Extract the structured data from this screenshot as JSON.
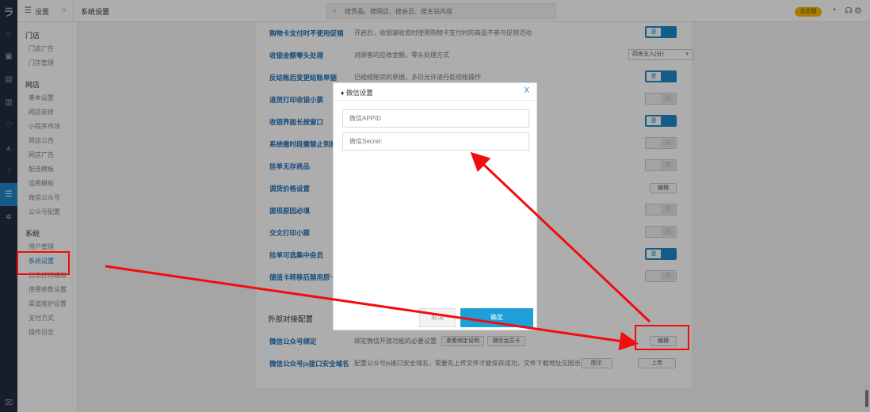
{
  "rail": {
    "logo": "ラ",
    "icons": [
      "home-icon",
      "store-icon",
      "calendar-icon",
      "report-icon",
      "heart-icon",
      "chart-icon",
      "stats-icon",
      "settings-list-icon",
      "puzzle-icon"
    ],
    "bottom": "⌧"
  },
  "topbar": {
    "menu_label": "设置",
    "page_title": "系统设置",
    "search_placeholder": "搜货品、搜网店、搜会员、搜主站内容",
    "badge": "企业版"
  },
  "sidebar": {
    "groups": [
      {
        "title": "门店",
        "items": [
          "门店广告",
          "门店管理"
        ]
      },
      {
        "title": "网店",
        "items": [
          "基本设置",
          "网店装修",
          "小程序市场",
          "网店公告",
          "网店广告",
          "配送模板",
          "运费模板",
          "微信公众号",
          "公众号配置"
        ]
      },
      {
        "title": "系统",
        "items": [
          "用户管理",
          "系统设置",
          "员工打印模版",
          "使用参数设置",
          "渠道维护设置",
          "支付方式",
          "操作日志"
        ]
      }
    ]
  },
  "settings": {
    "rows": [
      {
        "label": "购物卡支付时不使用促销",
        "desc": "开启后，收银端收款时使用购物卡支付时的商品不参与促销活动"
      },
      {
        "label": "收银金额零头处理",
        "desc": "对顾客的应收金额，零头处理方式"
      },
      {
        "label": "反结账后变更结账单据",
        "desc": "已经结账完的单据，多日允许进行反结账操作"
      },
      {
        "label": "退货打印收银小票",
        "desc": ""
      },
      {
        "label": "收银界面长按窗口",
        "desc": ""
      },
      {
        "label": "系统缴时段需禁止到期",
        "desc": ""
      },
      {
        "label": "挂单无存商品",
        "desc": ""
      },
      {
        "label": "调货价格设置",
        "desc": ""
      },
      {
        "label": "提现原因必填",
        "desc": ""
      },
      {
        "label": "交文打印小票",
        "desc": ""
      },
      {
        "label": "挂单可选集中会员",
        "desc": ""
      },
      {
        "label": "储值卡转移后禁用原卡",
        "desc": ""
      }
    ],
    "rounding_select": "四舍五入(分)",
    "toggle_on_label": "是",
    "toggle_off_label": "否",
    "edit_label": "编辑",
    "section2_title": "外部对接配置",
    "ext_rows": [
      {
        "label": "微信公众号绑定",
        "desc": "绑定微信开放功能的必要设置",
        "btn1": "查看绑定说明",
        "btn2": "微信会员卡",
        "action": "编辑"
      },
      {
        "label": "微信公众号js接口安全域名",
        "desc": "配置公众号js接口安全域名，需要先上传文件才能保存成功，文件下载地址见图示",
        "btn1": "图示",
        "action": "上传"
      }
    ]
  },
  "modal": {
    "title": "微信设置",
    "close": "X",
    "appid_placeholder": "微信APPID",
    "secret_placeholder": "微信Secret:",
    "cancel": "取消",
    "confirm": "确定"
  },
  "colors": {
    "accent": "#1e88c8",
    "annotation": "#f20c0c",
    "badge": "#f5b800"
  }
}
